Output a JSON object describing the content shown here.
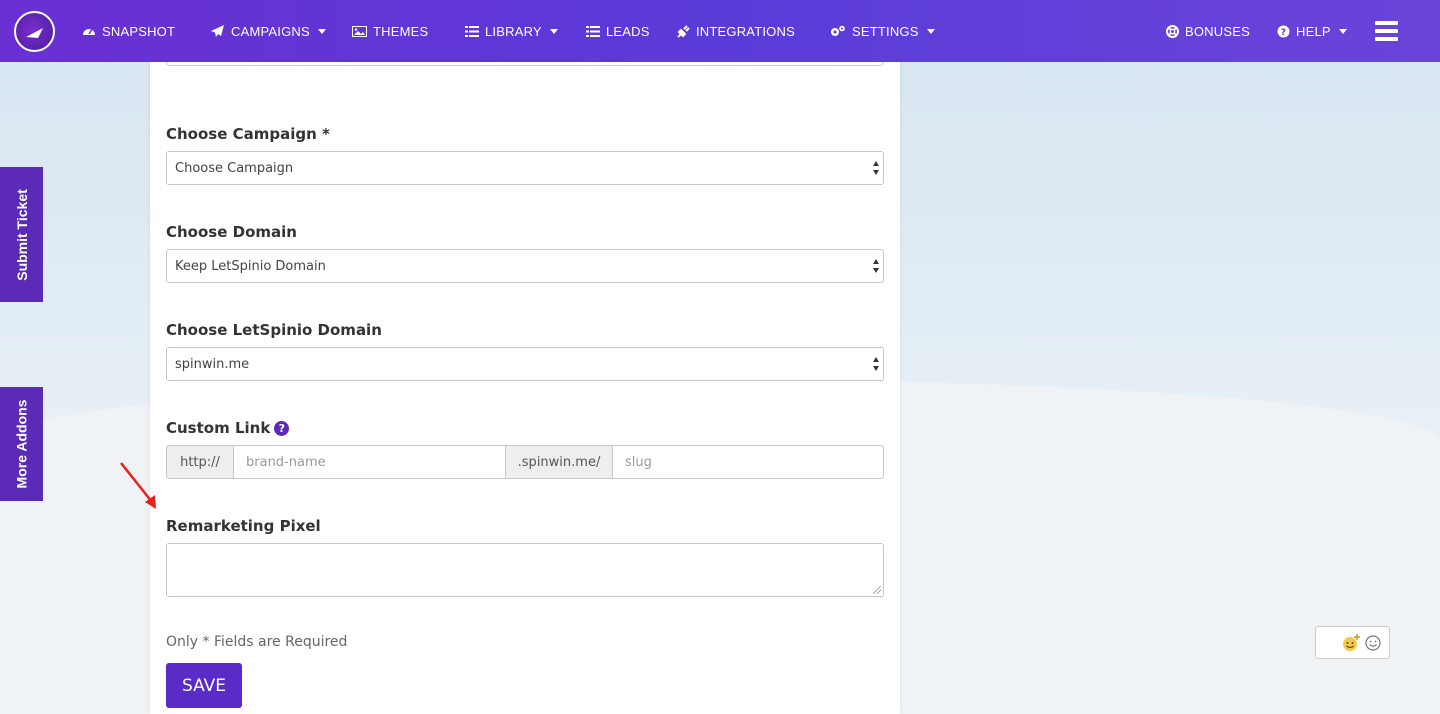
{
  "nav": {
    "items": [
      {
        "label": "SNAPSHOT",
        "icon": "dashboard-icon"
      },
      {
        "label": "CAMPAIGNS",
        "icon": "paper-plane-icon",
        "dropdown": true
      },
      {
        "label": "THEMES",
        "icon": "image-icon"
      },
      {
        "label": "LIBRARY",
        "icon": "list-icon",
        "dropdown": true
      },
      {
        "label": "LEADS",
        "icon": "list-icon"
      },
      {
        "label": "INTEGRATIONS",
        "icon": "plug-icon"
      },
      {
        "label": "SETTINGS",
        "icon": "gears-icon",
        "dropdown": true
      },
      {
        "label": "BONUSES",
        "icon": "life-ring-icon"
      },
      {
        "label": "HELP",
        "icon": "question-circle-icon",
        "dropdown": true
      }
    ]
  },
  "side_tabs": {
    "submit_ticket": "Submit Ticket",
    "more_addons": "More Addons"
  },
  "form": {
    "campaign": {
      "label": "Choose Campaign *",
      "value": "Choose Campaign"
    },
    "domain": {
      "label": "Choose Domain",
      "value": "Keep LetSpinio Domain"
    },
    "letspinio_domain": {
      "label": "Choose LetSpinio Domain",
      "value": "spinwin.me"
    },
    "custom_link": {
      "label": "Custom Link",
      "help_glyph": "?",
      "prefix": "http://",
      "brand_placeholder": "brand-name",
      "middle": ".spinwin.me/",
      "slug_placeholder": "slug"
    },
    "remarketing": {
      "label": "Remarketing Pixel",
      "value": ""
    },
    "note": "Only * Fields are Required",
    "save_label": "SAVE"
  },
  "colors": {
    "nav": "#5a3bd8",
    "accent": "#5b2bc8",
    "arrow": "#e8201a"
  }
}
